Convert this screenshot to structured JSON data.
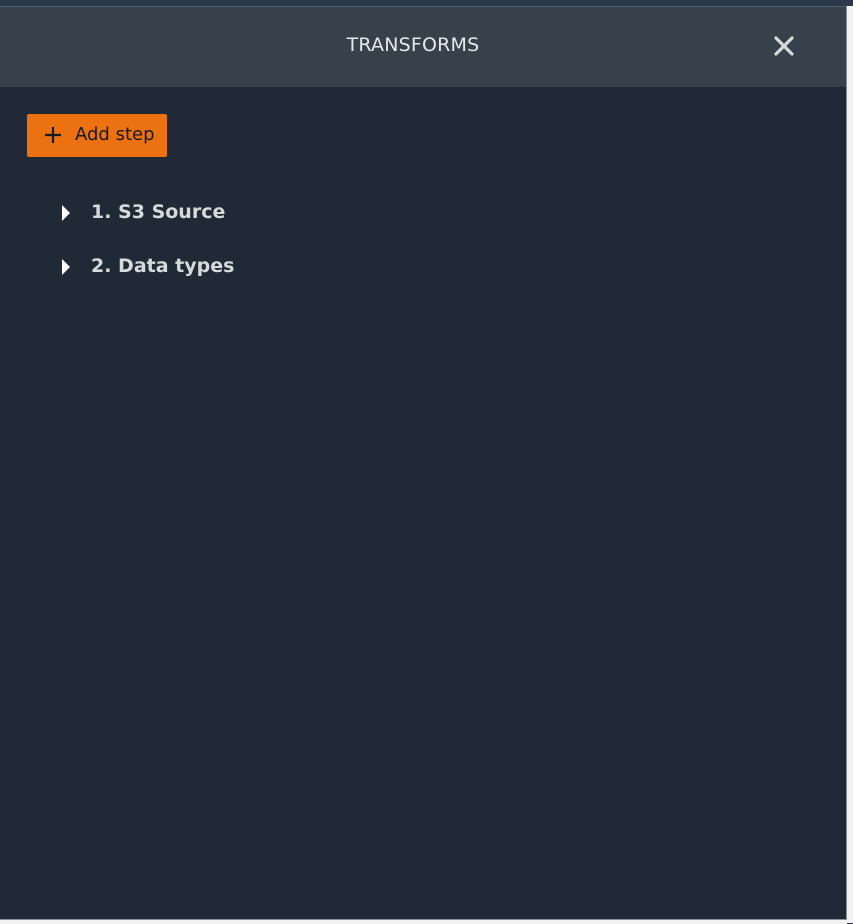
{
  "panel": {
    "title": "TRANSFORMS",
    "close_icon": "close-icon"
  },
  "toolbar": {
    "add_step_label": "Add step",
    "add_step_icon": "plus-icon",
    "add_step_color": "#ec7211"
  },
  "steps": [
    {
      "label": "1. S3 Source",
      "icon": "caret-right-icon"
    },
    {
      "label": "2. Data types",
      "icon": "caret-right-icon"
    }
  ],
  "colors": {
    "background": "#202a36",
    "header": "#37414c",
    "text": "#d5dbdb"
  }
}
